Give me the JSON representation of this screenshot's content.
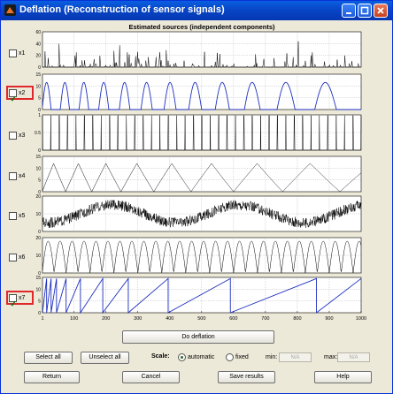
{
  "window": {
    "title": "Deflation (Reconstruction of sensor signals)"
  },
  "colors": {
    "selected_series": "#1d2fbf",
    "unselected_series": "#000000",
    "highlight": "#e0282c",
    "title_bar": "#0746c6"
  },
  "chart_data": {
    "type": "line",
    "title": "Estimated sources (independent components)",
    "x_ticks": [
      "1",
      "100",
      "200",
      "300",
      "400",
      "500",
      "600",
      "700",
      "800",
      "900",
      "1000"
    ],
    "xlim": [
      1,
      1000
    ],
    "grid": true,
    "panels": [
      {
        "name": "x1",
        "checked": false,
        "y_ticks": [
          "0",
          "20",
          "40",
          "60"
        ],
        "ylim": [
          0,
          60
        ],
        "kind": "spikes"
      },
      {
        "name": "x2",
        "checked": true,
        "y_ticks": [
          "0",
          "5",
          "10",
          "15"
        ],
        "ylim": [
          0,
          15
        ],
        "kind": "half-sine chirp"
      },
      {
        "name": "x3",
        "checked": false,
        "y_ticks": [
          "0",
          "0.5",
          "1"
        ],
        "ylim": [
          0,
          1
        ],
        "kind": "pulse train"
      },
      {
        "name": "x4",
        "checked": false,
        "y_ticks": [
          "0",
          "5",
          "10",
          "15"
        ],
        "ylim": [
          0,
          15
        ],
        "kind": "triangle"
      },
      {
        "name": "x5",
        "checked": false,
        "y_ticks": [
          "0",
          "10",
          "20"
        ],
        "ylim": [
          0,
          20
        ],
        "kind": "noisy sine"
      },
      {
        "name": "x6",
        "checked": false,
        "y_ticks": [
          "0",
          "10",
          "20"
        ],
        "ylim": [
          0,
          20
        ],
        "kind": "rectified sine"
      },
      {
        "name": "x7",
        "checked": true,
        "y_ticks": [
          "0",
          "5",
          "10",
          "15"
        ],
        "ylim": [
          0,
          15
        ],
        "kind": "sawtooth chirp"
      }
    ]
  },
  "labels": {
    "x1": "x1",
    "x2": "x2",
    "x3": "x3",
    "x4": "x4",
    "x5": "x5",
    "x6": "x6",
    "x7": "x7"
  },
  "buttons": {
    "deflate": "Do deflation",
    "select_all": "Select all",
    "unselect_all": "Unselect all",
    "return": "Return",
    "cancel": "Cancel",
    "save": "Save results",
    "help": "Help"
  },
  "scale": {
    "label": "Scale:",
    "automatic": "automatic",
    "fixed": "fixed",
    "min_label": "min:",
    "max_label": "max:",
    "min_value": "N/A",
    "max_value": "N/A",
    "selected": "automatic"
  }
}
